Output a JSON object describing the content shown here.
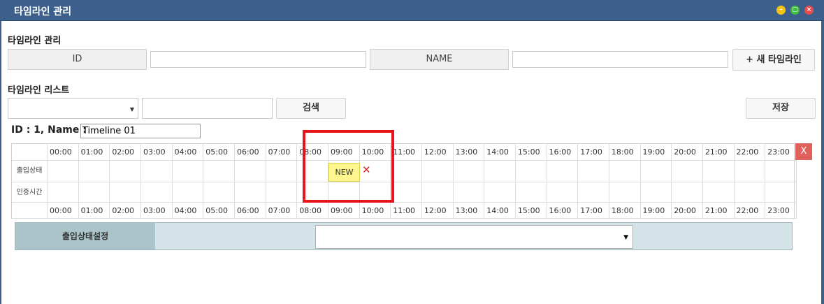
{
  "window": {
    "title": "타임라인 관리",
    "buttons": {
      "minimize": "–",
      "maximize": "▢",
      "close": "×"
    }
  },
  "management": {
    "section_title": "타임라인 관리",
    "id_header": "ID",
    "id_value": "",
    "name_header": "NAME",
    "name_value": "",
    "new_timeline_button": "+ 새 타임라인"
  },
  "list": {
    "section_title": "타임라인 리스트",
    "filter_select_value": "",
    "search_value": "",
    "search_button": "검색",
    "save_button": "저장"
  },
  "timeline": {
    "id_name_label": "ID : 1, Name :",
    "name_value": "Timeline 01",
    "hours": [
      "00:00",
      "01:00",
      "02:00",
      "03:00",
      "04:00",
      "05:00",
      "06:00",
      "07:00",
      "08:00",
      "09:00",
      "10:00",
      "11:00",
      "12:00",
      "13:00",
      "14:00",
      "15:00",
      "16:00",
      "17:00",
      "18:00",
      "19:00",
      "20:00",
      "21:00",
      "22:00",
      "23:00"
    ],
    "row_labels": [
      "출입상태",
      "인증시간"
    ],
    "new_block_label": "NEW",
    "new_block_hour": "09:00",
    "delete_mark": "✕",
    "remove_button": "X"
  },
  "status_setting": {
    "label": "출입상태설정",
    "select_value": "",
    "arrow": "▼"
  },
  "icons": {
    "select_arrow": "chevron-down-icon",
    "delete": "close-icon"
  },
  "colors": {
    "titlebar": "#3d5f8b",
    "new_block": "#fff68f",
    "delete_mark": "#e02020",
    "remove_button": "#e0605c",
    "highlight": "#e8141b",
    "status_bar": "#d3e3e8",
    "status_label": "#aac4c9"
  }
}
